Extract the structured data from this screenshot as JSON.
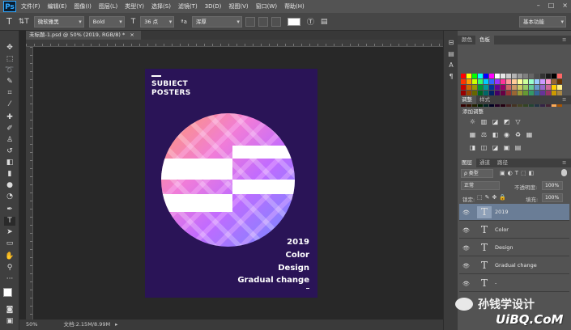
{
  "menubar": {
    "logo": "Ps",
    "items": [
      "文件(F)",
      "编辑(E)",
      "图像(I)",
      "图层(L)",
      "类型(Y)",
      "选择(S)",
      "滤镜(T)",
      "3D(D)",
      "视图(V)",
      "窗口(W)",
      "帮助(H)"
    ],
    "controls": [
      "–",
      "□",
      "×"
    ]
  },
  "options": {
    "font_family": "微软雅黑",
    "font_style": "Bold",
    "font_size": "36 点",
    "aa_label": "ªa",
    "antialias": "浑厚",
    "workspace": "基本功能"
  },
  "document": {
    "tab_label": "未标题-1.psd @ 50% (2019, RGB/8) *",
    "tab_close": "×"
  },
  "poster": {
    "title_line1": "SUBIECT",
    "title_line2": "POSTERS",
    "lines": [
      "2019",
      "Color",
      "Design",
      "Gradual change"
    ]
  },
  "status": {
    "zoom": "50%",
    "doc_info": "文档:2.15M/8.99M"
  },
  "panels": {
    "color_tab": "颜色",
    "swatches_tab": "色板",
    "adjust_tab": "调整",
    "style_tab": "样式",
    "adjust_title": "添加调整",
    "layers_tab": "图层",
    "channels_tab": "通道",
    "paths_tab": "路径",
    "filter_kind": "ρ 类型",
    "blend_mode": "正常",
    "opacity_label": "不透明度:",
    "opacity_value": "100%",
    "lock_label": "锁定:",
    "fill_label": "填充:",
    "fill_value": "100%"
  },
  "layers": [
    {
      "name": "2019",
      "selected": true
    },
    {
      "name": "Color",
      "selected": false
    },
    {
      "name": "Design",
      "selected": false
    },
    {
      "name": "Gradual change",
      "selected": false
    },
    {
      "name": "-",
      "selected": false
    }
  ],
  "watermark": {
    "text": "孙钱学设计",
    "site": "UiBQ.CoM"
  },
  "colors": {
    "poster_bg": "#2a1457",
    "selected_layer": "#6a7d96",
    "accent": "#31a8ff"
  }
}
